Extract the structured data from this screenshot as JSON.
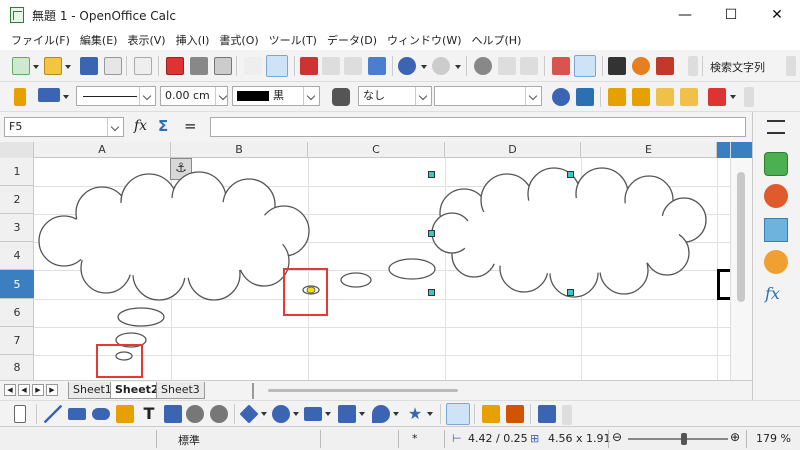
{
  "window": {
    "title": "無題 1 - OpenOffice Calc"
  },
  "menu": [
    "ファイル(F)",
    "編集(E)",
    "表示(V)",
    "挿入(I)",
    "書式(O)",
    "ツール(T)",
    "データ(D)",
    "ウィンドウ(W)",
    "ヘルプ(H)"
  ],
  "toolbar1": {
    "search_label": "検索文字列"
  },
  "toolbar2": {
    "line_width": "0.00 cm",
    "line_color": "黒",
    "area_style": "なし",
    "area_fill": ""
  },
  "formula": {
    "cell_ref": "F5",
    "content": ""
  },
  "columns": [
    "A",
    "B",
    "C",
    "D",
    "E"
  ],
  "rows": [
    "1",
    "2",
    "3",
    "4",
    "5",
    "6",
    "7",
    "8"
  ],
  "selected_row": "5",
  "sheets": [
    "Sheet1",
    "Sheet2",
    "Sheet3"
  ],
  "active_sheet": "Sheet2",
  "status": {
    "style": "標準",
    "mode": "*",
    "position": "4.42 / 0.25",
    "size": "4.56 x 1.91",
    "zoom": "179 %",
    "zoom_fraction": 0.56
  },
  "colors": {
    "accent": "#3c7fc1",
    "handle": "#39c8c8",
    "highlight": "#e53935",
    "glue_point": "#f5e000"
  }
}
